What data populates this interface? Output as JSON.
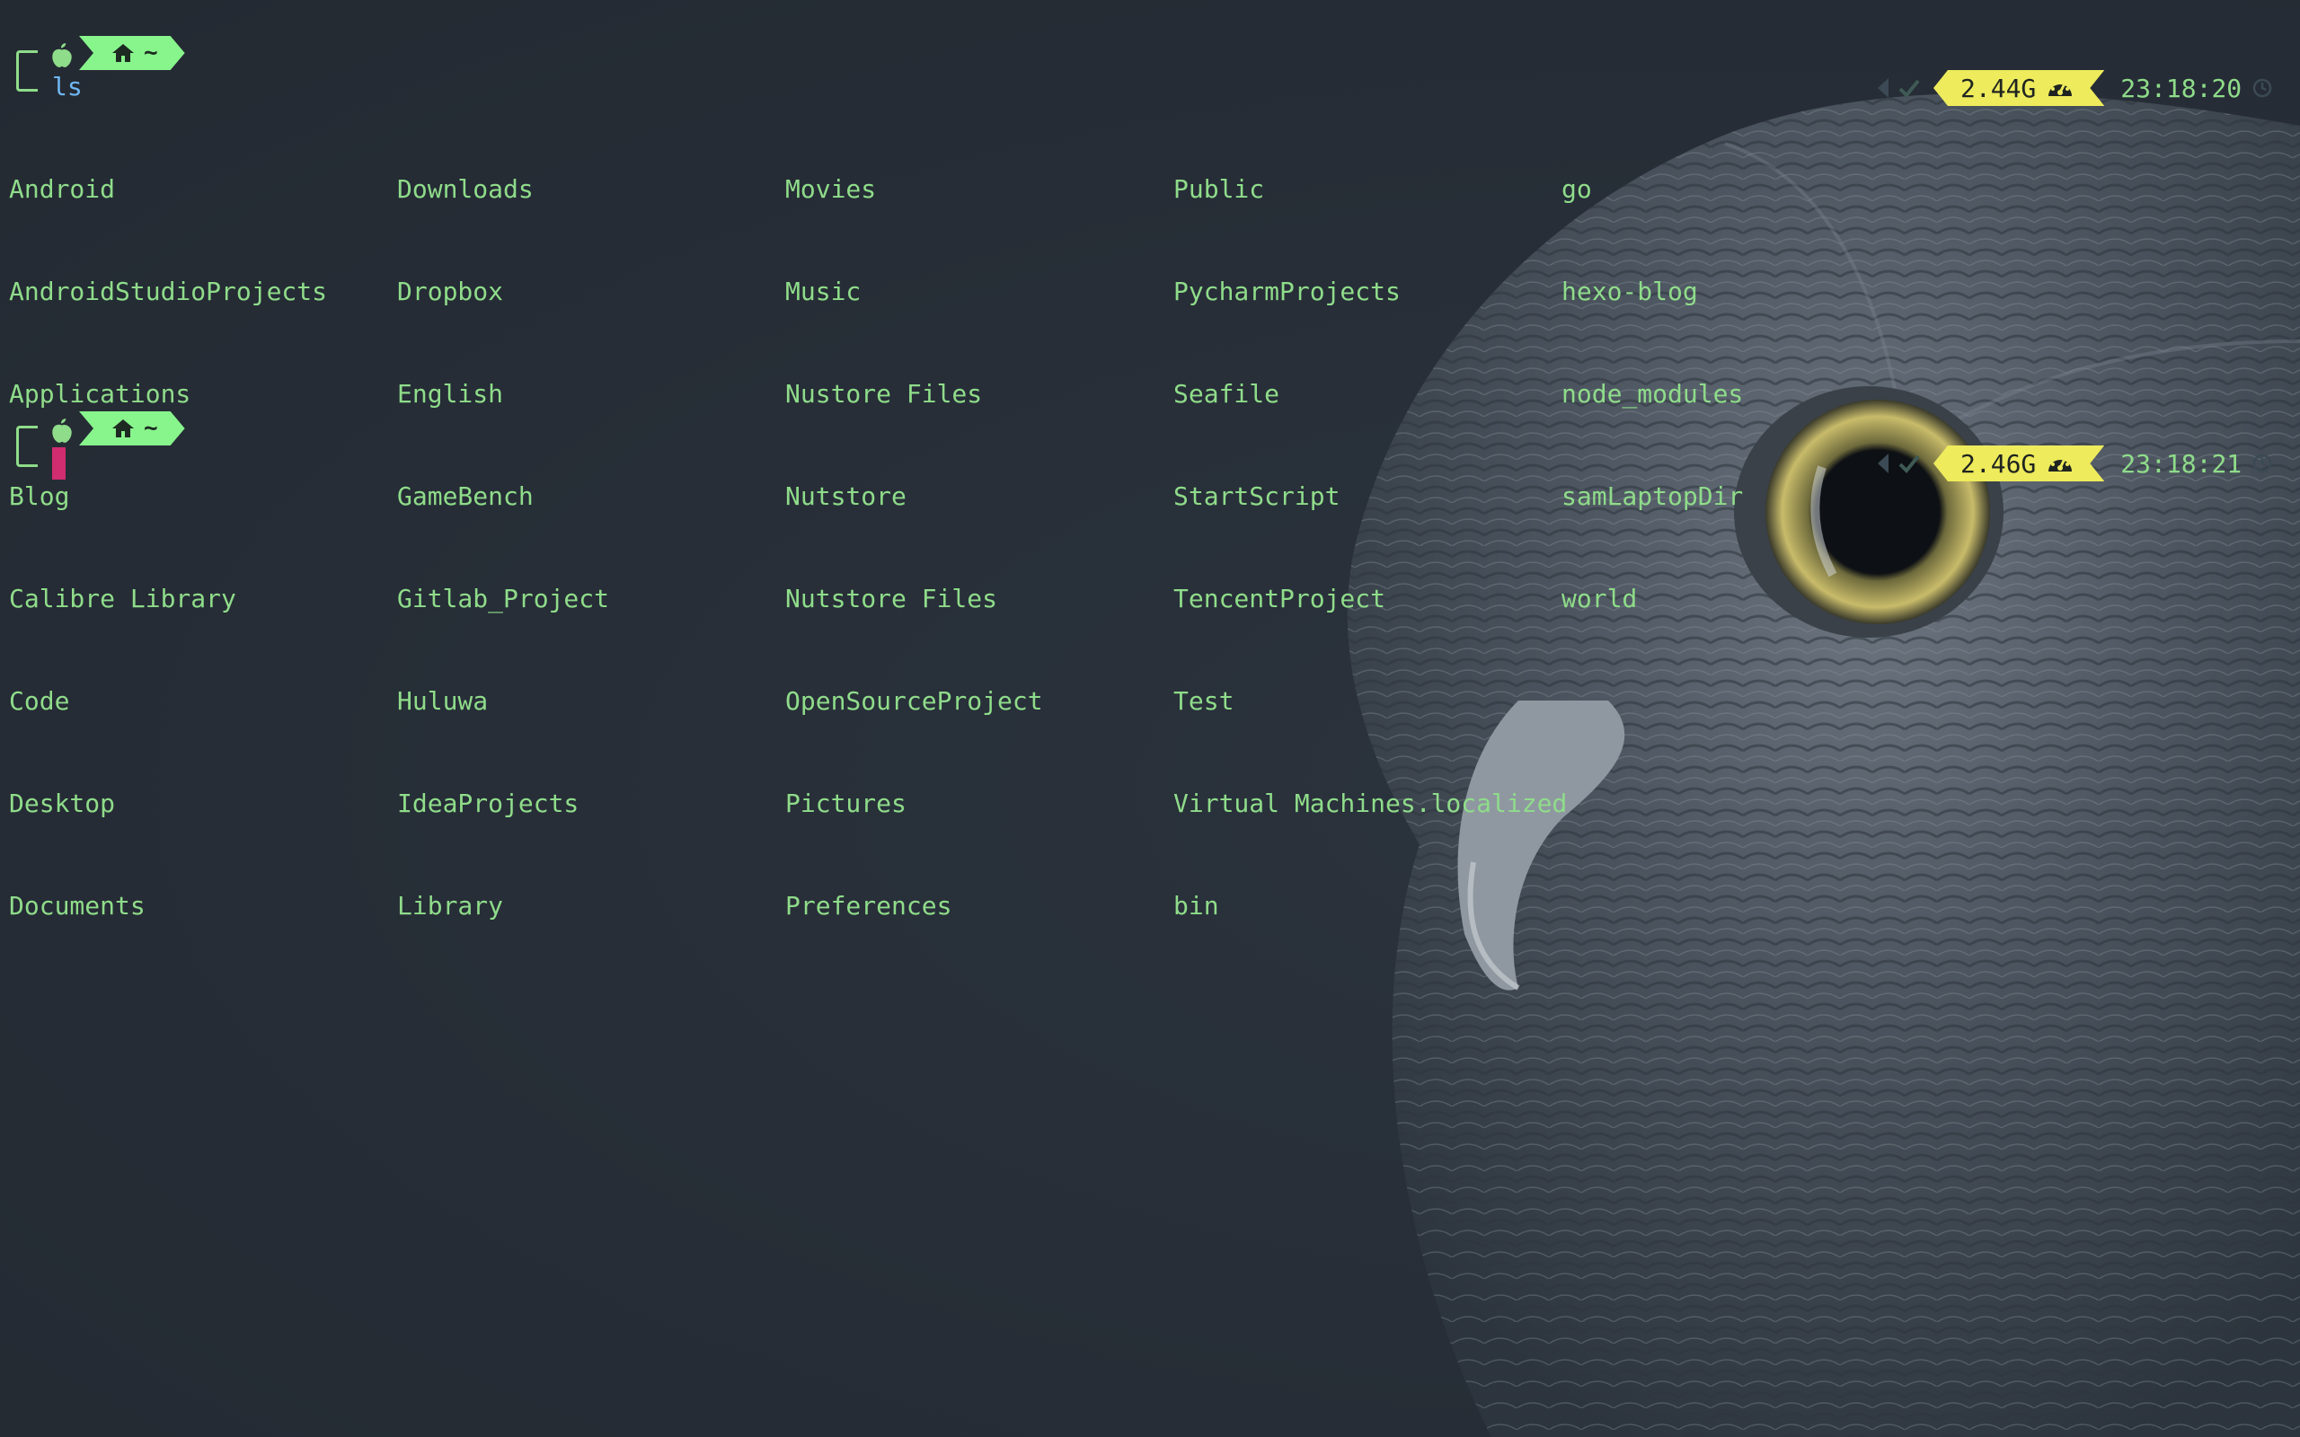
{
  "prompt": {
    "home_label": "~",
    "command": "ls"
  },
  "ls": {
    "columns": [
      [
        "Android",
        "AndroidStudioProjects",
        "Applications",
        "Blog",
        "Calibre Library",
        "Code",
        "Desktop",
        "Documents"
      ],
      [
        "Downloads",
        "Dropbox",
        "English",
        "GameBench",
        "Gitlab_Project",
        "Huluwa",
        "IdeaProjects",
        "Library"
      ],
      [
        "Movies",
        "Music",
        "Nustore Files",
        "Nutstore",
        "Nutstore Files",
        "OpenSourceProject",
        "Pictures",
        "Preferences"
      ],
      [
        "Public",
        "PycharmProjects",
        "Seafile",
        "StartScript",
        "TencentProject",
        "Test",
        "Virtual Machines.localized",
        "bin"
      ],
      [
        "go",
        "hexo-blog",
        "node_modules",
        "samLaptopDir",
        "world"
      ]
    ]
  },
  "status": [
    {
      "memory": "2.44G",
      "time": "23:18:20"
    },
    {
      "memory": "2.46G",
      "time": "23:18:21"
    }
  ],
  "colors": {
    "background": "#272e37",
    "listing_text": "#8fdc8a",
    "command_text": "#6fb7f2",
    "home_segment": "#88f48c",
    "memory_segment": "#eeeb5c",
    "cursor": "#d02c70"
  },
  "icons": {
    "os": "apple-icon",
    "home": "home-icon",
    "memory": "gauge-icon",
    "success": "check-icon",
    "separator": "chevron-left-icon",
    "clock": "clock-icon"
  }
}
